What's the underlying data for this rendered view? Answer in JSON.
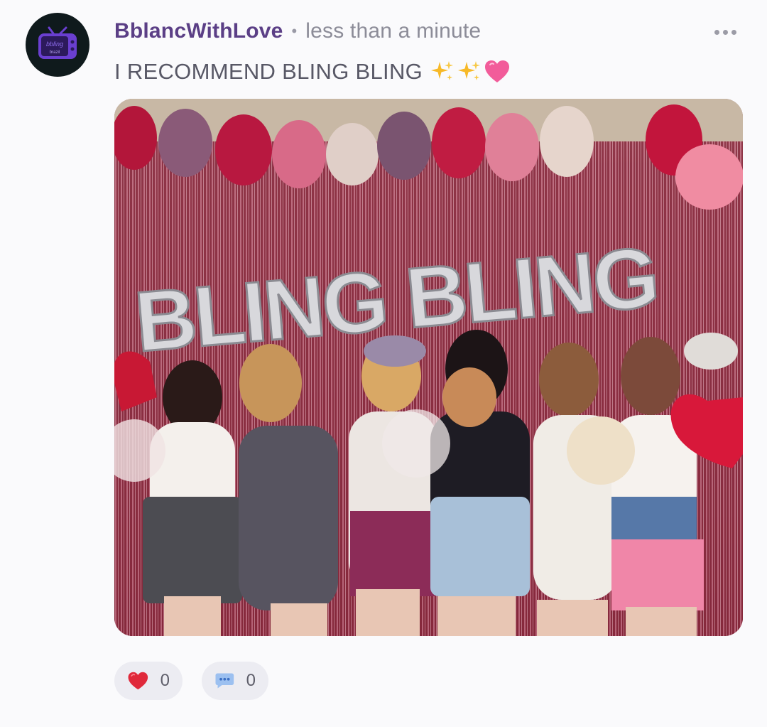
{
  "post": {
    "username": "BblancWithLove",
    "separator": "•",
    "timestamp": "less than a minute",
    "text": "I RECOMMEND BLING BLING",
    "emojis": "✨✨💗"
  },
  "avatar": {
    "icon": "tv-logo-icon",
    "logo_text": "bbling"
  },
  "photo": {
    "description_icon": "group-photo-image",
    "banner_text": "BLING BLING"
  },
  "reactions": {
    "like_count": "0",
    "comment_count": "0"
  },
  "colors": {
    "username": "#5b3f86",
    "timestamp": "#8c8c98",
    "heart": "#e0293b",
    "comment_bubble": "#9cc0f0",
    "chip_bg": "#ececf2"
  }
}
